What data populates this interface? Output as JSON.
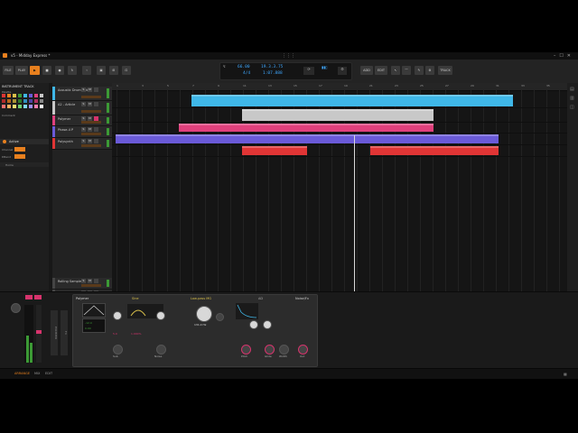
{
  "window": {
    "title": "v5 - Midday Express *"
  },
  "toolbar": {
    "file_label": "FILE",
    "play_label": "PLAY",
    "tempo": "66.00",
    "time_signature": "4/4",
    "position_bars": "19.3.3.75",
    "position_time": "1:07.888",
    "mode_labels": [
      "ADD",
      "EDIT",
      "TRACK"
    ],
    "accent_color": "#e8801e"
  },
  "browser": {
    "header": "INSTRUMENT TRACK",
    "palette_label": "Palette",
    "comment_label": "Comment",
    "active_label": "Active",
    "channel_label": "Channel",
    "pbend_label": "P.Bend",
    "input_label": "Home",
    "fx_label": "All Ins",
    "master_label": "Master"
  },
  "tracks": [
    {
      "name": "Acoustic Drums Kit",
      "color": "#3fb7e8"
    },
    {
      "name": "A2 - Article",
      "color": "#c8c8c8"
    },
    {
      "name": "Polymer",
      "color": "#e0407c"
    },
    {
      "name": "Phase-4 P",
      "color": "#6a5ad8"
    },
    {
      "name": "Polysynth",
      "color": "#e03535"
    },
    {
      "name": "Rolling Sampler",
      "color": "#444444"
    },
    {
      "name": "Master",
      "color": "#444444"
    }
  ],
  "ruler": {
    "bars": [
      "1",
      "3",
      "5",
      "7",
      "9",
      "11",
      "13",
      "15",
      "17",
      "19",
      "21",
      "23",
      "25",
      "27",
      "29",
      "31",
      "33",
      "35"
    ]
  },
  "device": {
    "name": "Polymer",
    "osc_label": "Sine",
    "filter_label": "Low-pass MG",
    "env_label": "AD",
    "mod_label": "Noise/Fx",
    "cutoff_value": "131.0 Hz",
    "knob_labels": [
      "Sub",
      "Noise",
      "Pitch",
      "Glide",
      "Width",
      "Out"
    ],
    "small_values": [
      "-12.0",
      "5.0",
      "1.000%",
      "0.00"
    ]
  },
  "status": {
    "arrange_label": "ARRANGE",
    "mix_label": "MIX",
    "edit_label": "EDIT"
  }
}
